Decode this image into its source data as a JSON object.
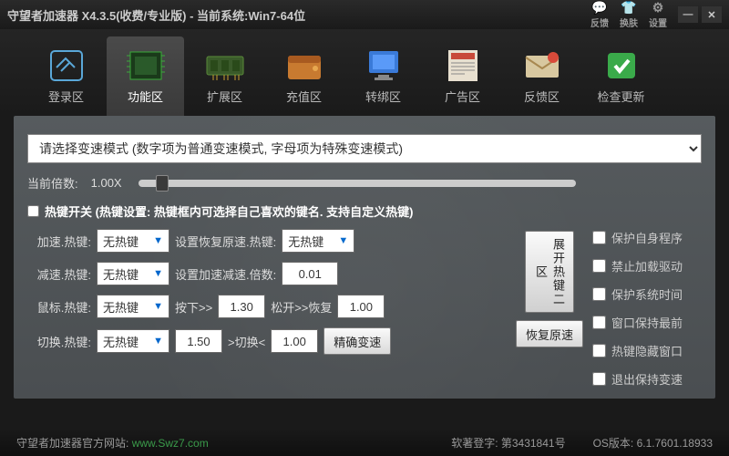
{
  "title": "守望者加速器 X4.3.5(收费/专业版) - 当前系统:Win7-64位",
  "titlebar_icons": {
    "feedback": "反馈",
    "skin": "换肤",
    "settings": "设置"
  },
  "tabs": [
    {
      "label": "登录区"
    },
    {
      "label": "功能区"
    },
    {
      "label": "扩展区"
    },
    {
      "label": "充值区"
    },
    {
      "label": "转绑区"
    },
    {
      "label": "广告区"
    },
    {
      "label": "反馈区"
    },
    {
      "label": "检查更新"
    }
  ],
  "mode_placeholder": "请选择变速模式 (数字项为普通变速模式, 字母项为特殊变速模式)",
  "multiplier_label": "当前倍数:",
  "multiplier_value": "1.00X",
  "hotkey_toggle_label": "热键开关 (热键设置: 热键框内可选择自己喜欢的键名. 支持自定义热键)",
  "controls": {
    "accel": {
      "label": "加速.热键:",
      "hotkey": "无热键",
      "mid": "设置恢复原速.热键:",
      "val": "无热键"
    },
    "decel": {
      "label": "减速.热键:",
      "hotkey": "无热键",
      "mid": "设置加速减速.倍数:",
      "val": "0.01"
    },
    "mouse": {
      "label": "鼠标.热键:",
      "hotkey": "无热键",
      "mid1": "按下>>",
      "v1": "1.30",
      "mid2": "松开>>恢复",
      "v2": "1.00"
    },
    "switch": {
      "label": "切换.热键:",
      "hotkey": "无热键",
      "v1": "1.50",
      "mid": ">切换<",
      "v2": "1.00"
    }
  },
  "buttons": {
    "expand": "展开热键二区",
    "precise": "精确变速",
    "restore": "恢复原速"
  },
  "checks": [
    "保护自身程序",
    "禁止加载驱动",
    "保护系统时间",
    "窗口保持最前",
    "热键隐藏窗口",
    "退出保持变速"
  ],
  "footer": {
    "site_label": "守望者加速器官方网站:",
    "site_url": "www.Swz7.com",
    "soft_reg": "软著登字: 第3431841号",
    "os_ver": "OS版本: 6.1.7601.18933"
  }
}
